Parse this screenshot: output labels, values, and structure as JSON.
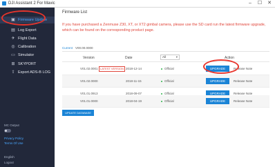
{
  "window": {
    "title": "DJI Assistant 2 For Mavic",
    "controls": [
      "–",
      "☐",
      "✕"
    ]
  },
  "sidebar": {
    "items": [
      {
        "label": "Firmware Update",
        "icon": "firmware-icon",
        "active": true
      },
      {
        "label": "Log Export",
        "icon": "log-icon",
        "active": false
      },
      {
        "label": "Flight Data",
        "icon": "flight-data-icon",
        "active": false
      },
      {
        "label": "Calibration",
        "icon": "calibration-icon",
        "active": false
      },
      {
        "label": "Simulator",
        "icon": "simulator-icon",
        "active": false
      },
      {
        "label": "SKYPORT",
        "icon": "skyport-icon",
        "active": false
      },
      {
        "label": "Export ADS-B LOG",
        "icon": "export-icon",
        "active": false
      }
    ],
    "mc_output_label": "MC Output",
    "privacy_policy": "Privacy Policy",
    "terms_of_use": "Terms Of Use",
    "language": "English",
    "logout": "Logout"
  },
  "main": {
    "title": "Firmware List",
    "notice": "If you have purchased a Zenmuse Z30, XT, or XT2 gimbal camera, please use the SD card run the latest firmware upgrade, which can be found on the corresponding product page.",
    "tabs": {
      "current": "Current",
      "separator": ":",
      "version": "V00.00.0000"
    },
    "headers": {
      "version": "Version",
      "date": "Date",
      "filter": "All",
      "action": "Action"
    },
    "rows": [
      {
        "version": "V01.02.0001",
        "badge": "LATEST VERSION",
        "date": "2018-12-14",
        "status": "Official",
        "upgrade": "UPGRADE",
        "release": "Release Note"
      },
      {
        "version": "V01.02.0000",
        "badge": "",
        "date": "2018-11-15",
        "status": "Official",
        "upgrade": "UPGRADE",
        "release": "Release Note"
      },
      {
        "version": "V01.01.0913",
        "badge": "",
        "date": "2018-09-07",
        "status": "Official",
        "upgrade": "UPGRADE",
        "release": "Release Note"
      },
      {
        "version": "V01.01.0000",
        "badge": "",
        "date": "2018-04-19",
        "status": "Official",
        "upgrade": "UPGRADE",
        "release": "Release Note"
      }
    ],
    "update_database": "UPDATE DATABASE"
  },
  "colors": {
    "accent": "#1b84d6",
    "sidebar": "#22283a",
    "warning": "#e0453a",
    "highlight": "#e8352c"
  }
}
